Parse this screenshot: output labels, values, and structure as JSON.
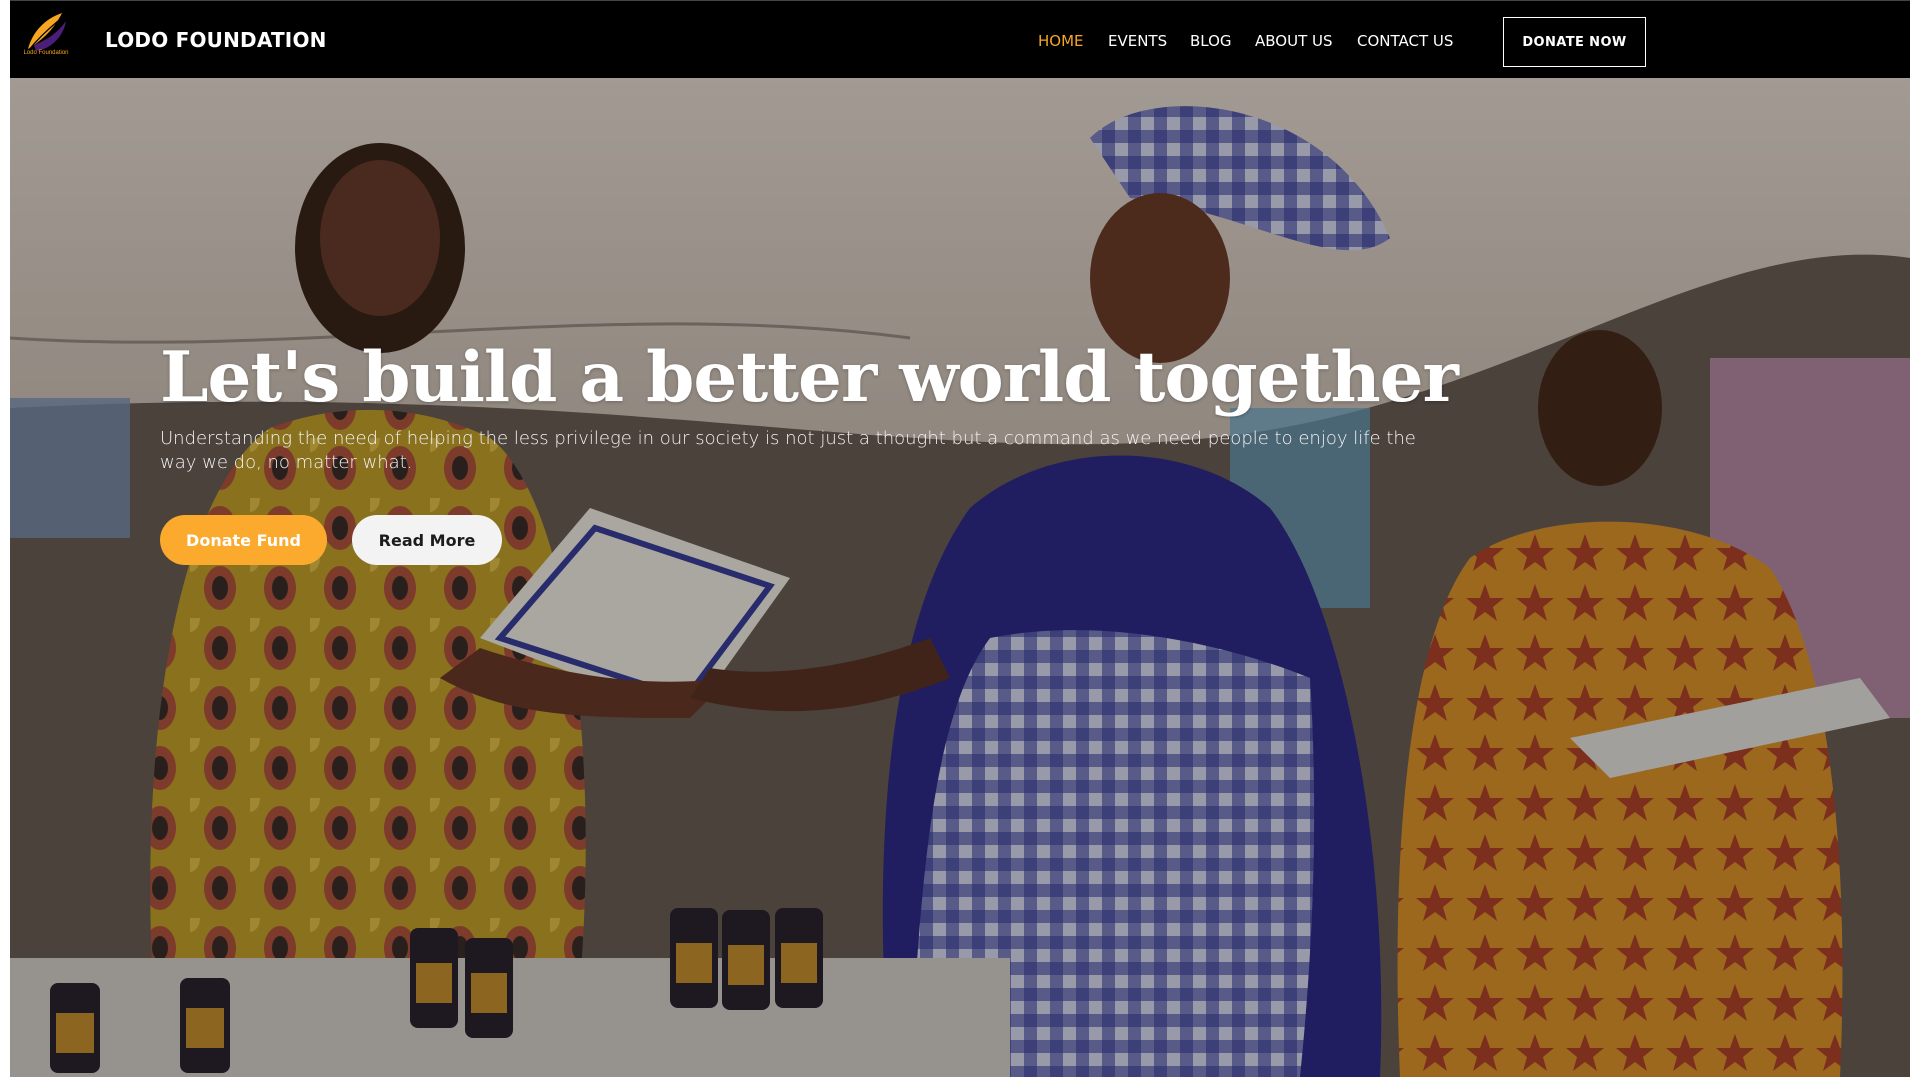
{
  "brand": {
    "name": "LODO FOUNDATION",
    "logo_caption": "Lodo Foundation",
    "logo_icon": "feather-leaf-logo"
  },
  "nav": {
    "items": [
      {
        "label": "HOME",
        "active": true
      },
      {
        "label": "EVENTS",
        "active": false
      },
      {
        "label": "BLOG",
        "active": false
      },
      {
        "label": "ABOUT US",
        "active": false
      },
      {
        "label": "CONTACT US",
        "active": false
      }
    ],
    "cta": "DONATE NOW"
  },
  "hero": {
    "title": "Let's build a better world together",
    "subtitle": "Understanding the need of helping the less privilege in our society is not just a thought but a command as we need people to enjoy life the way we do, no matter what.",
    "primary_button": "Donate Fund",
    "secondary_button": "Read More"
  },
  "colors": {
    "accent": "#f6a623",
    "button_primary": "#fbaa2e",
    "navbar": "#000000"
  }
}
